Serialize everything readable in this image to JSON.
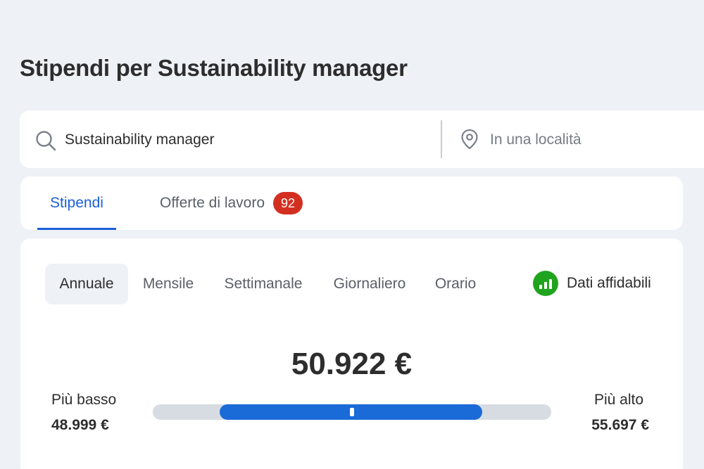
{
  "page": {
    "title": "Stipendi per Sustainability manager"
  },
  "search": {
    "job_value": "Sustainability manager",
    "location_placeholder": "In una località"
  },
  "tabs": [
    {
      "label": "Stipendi",
      "active": true
    },
    {
      "label": "Offerte di lavoro",
      "badge": "92"
    }
  ],
  "period_tabs": [
    {
      "label": "Annuale",
      "active": true
    },
    {
      "label": "Mensile"
    },
    {
      "label": "Settimanale"
    },
    {
      "label": "Giornaliero"
    },
    {
      "label": "Orario"
    }
  ],
  "reliability": {
    "label": "Dati affidabili",
    "color": "#20a31f"
  },
  "salary": {
    "value": "50.922 €",
    "low_label": "Più basso",
    "low_value": "48.999 €",
    "high_label": "Più alto",
    "high_value": "55.697 €",
    "range_fill_start_fraction": 0.168,
    "range_fill_end_fraction": 0.827,
    "marker_fraction": 0.5
  },
  "colors": {
    "accent": "#1a5fd6",
    "badge": "#d32f20",
    "bar_fill": "#1a6ad8",
    "bar_track": "#d7dbe2"
  },
  "icons": {
    "search": "search-icon",
    "location": "location-pin-icon",
    "reliability": "signal-bars-icon"
  }
}
